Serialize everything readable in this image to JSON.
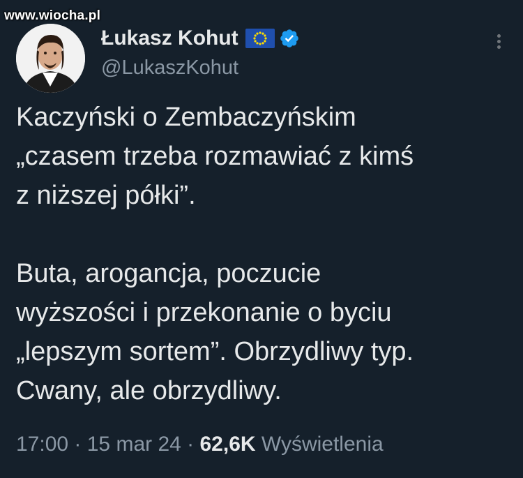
{
  "watermark": "www.wiocha.pl",
  "author": {
    "name": "Łukasz Kohut",
    "handle": "@LukaszKohut",
    "flag_icon": "eu-flag-icon",
    "verified_icon": "verified-badge-icon"
  },
  "tweet": {
    "paragraph1": "Kaczyński o Zembaczyńskim\n„czasem trzeba rozmawiać z kimś\nz niższej półki”.",
    "paragraph2": "Buta, arogancja, poczucie\nwyższości i przekonanie o byciu\n„lepszym sortem”. Obrzydliwy typ.\nCwany, ale obrzydliwy."
  },
  "meta": {
    "time": "17:00",
    "separator1": " · ",
    "date": "15 mar 24",
    "separator2": " · ",
    "views_count": "62,6K",
    "views_label": "Wyświetlenia"
  },
  "colors": {
    "background": "#15202b",
    "text": "#e7e9ea",
    "secondary": "#8b98a5",
    "verified": "#1d9bf0"
  }
}
